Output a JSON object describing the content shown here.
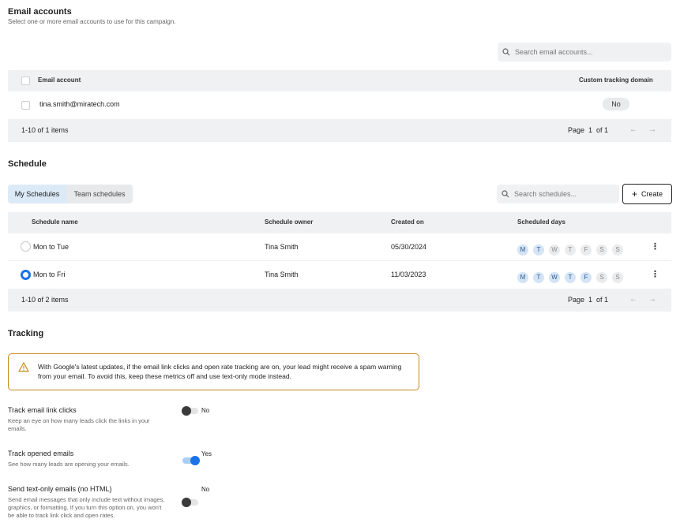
{
  "email_accounts": {
    "title": "Email accounts",
    "subtitle": "Select one or more email accounts to use for this campaign.",
    "search_placeholder": "Search email accounts...",
    "columns": {
      "account": "Email account",
      "tracking": "Custom tracking domain"
    },
    "rows": [
      {
        "email": "tina.smith@miratech.com",
        "tracking": "No"
      }
    ],
    "footer": {
      "items": "1-10 of 1 items",
      "page_label": "Page",
      "page": "1",
      "of_label": "of 1"
    }
  },
  "schedule": {
    "title": "Schedule",
    "tabs": [
      "My Schedules",
      "Team schedules"
    ],
    "search_placeholder": "Search schedules...",
    "create_label": "Create",
    "columns": {
      "name": "Schedule name",
      "owner": "Schedule owner",
      "created": "Created on",
      "days": "Scheduled days"
    },
    "rows": [
      {
        "name": "Mon to Tue",
        "owner": "Tina Smith",
        "created": "05/30/2024",
        "selected": false,
        "days_active": [
          true,
          true,
          false,
          false,
          false,
          false,
          false
        ]
      },
      {
        "name": "Mon to Fri",
        "owner": "Tina Smith",
        "created": "11/03/2023",
        "selected": true,
        "days_active": [
          true,
          true,
          true,
          true,
          true,
          false,
          false
        ]
      }
    ],
    "day_letters": [
      "M",
      "T",
      "W",
      "T",
      "F",
      "S",
      "S"
    ],
    "footer": {
      "items": "1-10 of 2 items",
      "page_label": "Page",
      "page": "1",
      "of_label": "of 1"
    }
  },
  "tracking": {
    "title": "Tracking",
    "warning": "With Google's latest updates, if the email link clicks and open rate tracking are on, your lead might receive a spam warning from your email. To avoid this, keep these metrics off and use text-only mode instead.",
    "accent_color": "#1a73e8",
    "warning_color": "#c68a1a",
    "options": [
      {
        "label": "Track email link clicks",
        "desc": "Keep an eye on how many leads click the links in your emails.",
        "state": "No",
        "on": false
      },
      {
        "label": "Track opened emails",
        "desc": "See how many leads are opening your emails.",
        "state": "Yes",
        "on": true
      },
      {
        "label": "Send text-only emails (no HTML)",
        "desc": "Send email messages that only include text without images, graphics, or formatting. If you turn this option on, you won't be able to track link click and open rates.",
        "state": "No",
        "on": false
      }
    ]
  }
}
